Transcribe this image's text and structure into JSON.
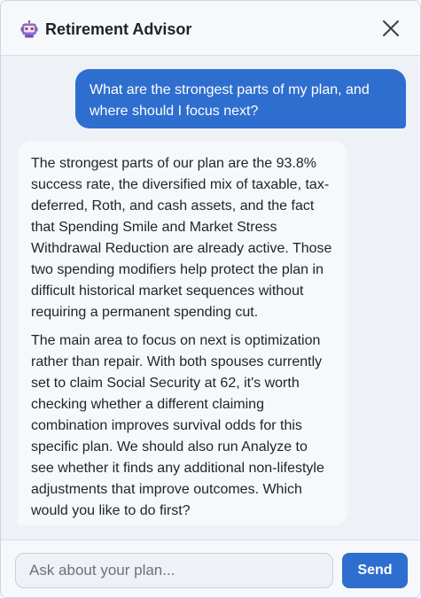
{
  "header": {
    "title": "Retirement Advisor",
    "logo_icon": "robot-icon",
    "close_icon": "close-icon"
  },
  "messages": {
    "user": "What are the strongest parts of my plan, and where should I focus next?",
    "assistant": {
      "paragraphs": [
        "The strongest parts of our plan are the 93.8% success rate, the diversified mix of taxable, tax-deferred, Roth, and cash assets, and the fact that Spending Smile and Market Stress Withdrawal Reduction are already active. Those two spending modifiers help protect the plan in difficult historical market sequences without requiring a permanent spending cut.",
        "The main area to focus on next is optimization rather than repair. With both spouses currently set to claim Social Security at 62, it's worth checking whether a different claiming combination improves survival odds for this specific plan. We should also run Analyze to see whether it finds any additional non-lifestyle adjustments that improve outcomes. Which would you like to do first?"
      ]
    }
  },
  "composer": {
    "input_value": "",
    "input_placeholder": "Ask about your plan...",
    "send_label": "Send"
  },
  "colors": {
    "accent": "#2e6ecf",
    "background": "#eef2f7",
    "bot_bubble": "#f7f8fb"
  }
}
